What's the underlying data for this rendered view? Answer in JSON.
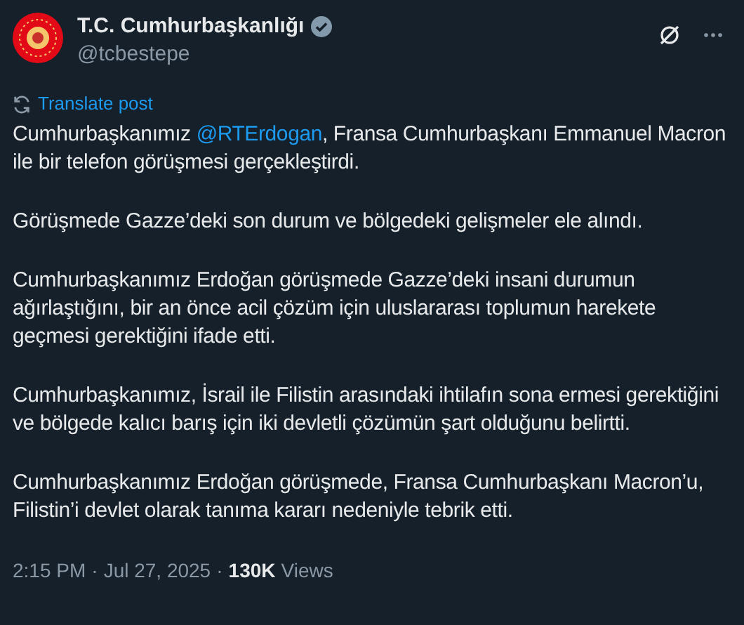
{
  "author": {
    "name": "T.C. Cumhurbaşkanlığı",
    "verified": true,
    "handle": "@tcbestepe"
  },
  "translate": {
    "label": "Translate post"
  },
  "paragraphs": [
    [
      {
        "kind": "text",
        "text": "Cumhurbaşkanımız "
      },
      {
        "kind": "mention",
        "text": "@RTErdogan"
      },
      {
        "kind": "text",
        "text": ", Fransa Cumhurbaşkanı Emmanuel Macron ile bir telefon görüşmesi gerçekleştirdi."
      }
    ],
    [
      {
        "kind": "text",
        "text": "Görüşmede Gazze’deki son durum ve bölgedeki gelişmeler ele alındı."
      }
    ],
    [
      {
        "kind": "text",
        "text": "Cumhurbaşkanımız Erdoğan görüşmede Gazze’deki insani durumun ağırlaştığını, bir an önce acil çözüm için uluslararası toplumun harekete geçmesi gerektiğini ifade etti."
      }
    ],
    [
      {
        "kind": "text",
        "text": "Cumhurbaşkanımız, İsrail ile Filistin arasındaki ihtilafın sona ermesi gerektiğini ve bölgede kalıcı barış için iki devletli çözümün şart olduğunu belirtti."
      }
    ],
    [
      {
        "kind": "text",
        "text": "Cumhurbaşkanımız Erdoğan görüşmede, Fransa Cumhurbaşkanı Macron’u, Filistin’i devlet olarak tanıma kararı nedeniyle tebrik etti."
      }
    ]
  ],
  "footer": {
    "time": "2:15 PM",
    "separator_1": "·",
    "date": "Jul 27, 2025",
    "separator_2": "·",
    "views_count": "130K",
    "views_label": "Views"
  }
}
